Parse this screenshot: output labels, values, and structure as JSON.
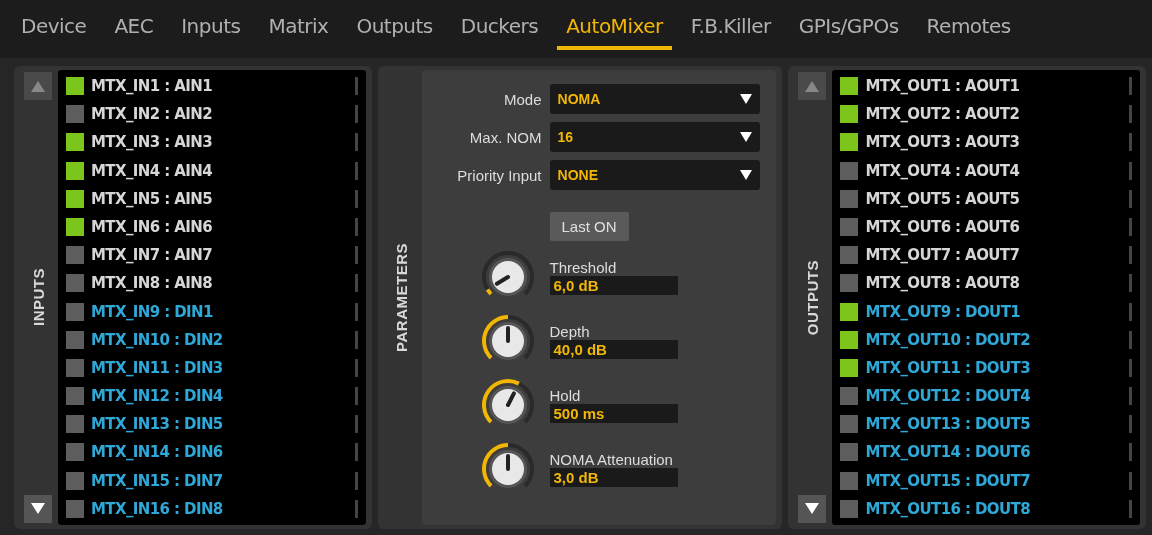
{
  "tabs": [
    {
      "label": "Device",
      "selected": false
    },
    {
      "label": "AEC",
      "selected": false
    },
    {
      "label": "Inputs",
      "selected": false
    },
    {
      "label": "Matrix",
      "selected": false
    },
    {
      "label": "Outputs",
      "selected": false
    },
    {
      "label": "Duckers",
      "selected": false
    },
    {
      "label": "AutoMixer",
      "selected": true
    },
    {
      "label": "F.B.Killer",
      "selected": false
    },
    {
      "label": "GPIs/GPOs",
      "selected": false
    },
    {
      "label": "Remotes",
      "selected": false
    }
  ],
  "inputs": {
    "title": "INPUTS",
    "scroll_up": {
      "disabled": true
    },
    "scroll_down": {
      "disabled": false
    },
    "channels": [
      {
        "name": "MTX_IN1 : AIN1",
        "kind": "analog",
        "on": true
      },
      {
        "name": "MTX_IN2 : AIN2",
        "kind": "analog",
        "on": false
      },
      {
        "name": "MTX_IN3 : AIN3",
        "kind": "analog",
        "on": true
      },
      {
        "name": "MTX_IN4 : AIN4",
        "kind": "analog",
        "on": true
      },
      {
        "name": "MTX_IN5 : AIN5",
        "kind": "analog",
        "on": true
      },
      {
        "name": "MTX_IN6 : AIN6",
        "kind": "analog",
        "on": true
      },
      {
        "name": "MTX_IN7 : AIN7",
        "kind": "analog",
        "on": false
      },
      {
        "name": "MTX_IN8 : AIN8",
        "kind": "analog",
        "on": false
      },
      {
        "name": "MTX_IN9 : DIN1",
        "kind": "digital",
        "on": false
      },
      {
        "name": "MTX_IN10 : DIN2",
        "kind": "digital",
        "on": false
      },
      {
        "name": "MTX_IN11 : DIN3",
        "kind": "digital",
        "on": false
      },
      {
        "name": "MTX_IN12 : DIN4",
        "kind": "digital",
        "on": false
      },
      {
        "name": "MTX_IN13 : DIN5",
        "kind": "digital",
        "on": false
      },
      {
        "name": "MTX_IN14 : DIN6",
        "kind": "digital",
        "on": false
      },
      {
        "name": "MTX_IN15 : DIN7",
        "kind": "digital",
        "on": false
      },
      {
        "name": "MTX_IN16 : DIN8",
        "kind": "digital",
        "on": false
      }
    ]
  },
  "parameters": {
    "title": "PARAMETERS",
    "selects": [
      {
        "label": "Mode",
        "value": "NOMA"
      },
      {
        "label": "Max. NOM",
        "value": "16"
      },
      {
        "label": "Priority Input",
        "value": "NONE"
      }
    ],
    "last_on_button": "Last ON",
    "knobs": [
      {
        "label": "Threshold",
        "value": "6,0 dB",
        "level": 0.05
      },
      {
        "label": "Depth",
        "value": "40,0 dB",
        "level": 0.5
      },
      {
        "label": "Hold",
        "value": "500 ms",
        "level": 0.6
      },
      {
        "label": "NOMA Attenuation",
        "value": "3,0 dB",
        "level": 0.5
      }
    ]
  },
  "outputs": {
    "title": "OUTPUTS",
    "scroll_up": {
      "disabled": true
    },
    "scroll_down": {
      "disabled": false
    },
    "channels": [
      {
        "name": "MTX_OUT1 : AOUT1",
        "kind": "analog",
        "on": true
      },
      {
        "name": "MTX_OUT2 : AOUT2",
        "kind": "analog",
        "on": true
      },
      {
        "name": "MTX_OUT3 : AOUT3",
        "kind": "analog",
        "on": true
      },
      {
        "name": "MTX_OUT4 : AOUT4",
        "kind": "analog",
        "on": false
      },
      {
        "name": "MTX_OUT5 : AOUT5",
        "kind": "analog",
        "on": false
      },
      {
        "name": "MTX_OUT6 : AOUT6",
        "kind": "analog",
        "on": false
      },
      {
        "name": "MTX_OUT7 : AOUT7",
        "kind": "analog",
        "on": false
      },
      {
        "name": "MTX_OUT8 : AOUT8",
        "kind": "analog",
        "on": false
      },
      {
        "name": "MTX_OUT9 : DOUT1",
        "kind": "digital",
        "on": true
      },
      {
        "name": "MTX_OUT10 : DOUT2",
        "kind": "digital",
        "on": true
      },
      {
        "name": "MTX_OUT11 : DOUT3",
        "kind": "digital",
        "on": true
      },
      {
        "name": "MTX_OUT12 : DOUT4",
        "kind": "digital",
        "on": false
      },
      {
        "name": "MTX_OUT13 : DOUT5",
        "kind": "digital",
        "on": false
      },
      {
        "name": "MTX_OUT14 : DOUT6",
        "kind": "digital",
        "on": false
      },
      {
        "name": "MTX_OUT15 : DOUT7",
        "kind": "digital",
        "on": false
      },
      {
        "name": "MTX_OUT16 : DOUT8",
        "kind": "digital",
        "on": false
      }
    ]
  }
}
